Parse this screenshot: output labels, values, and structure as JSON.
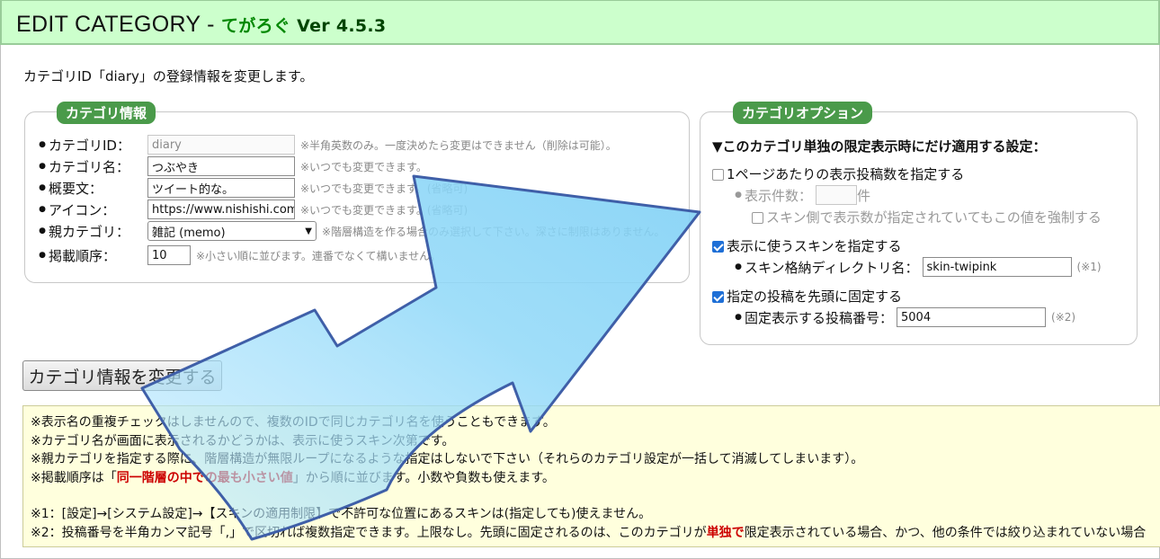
{
  "header": {
    "title_main": "EDIT CATEGORY - ",
    "title_app": "てがろぐ",
    "title_ver": " Ver 4.5.3"
  },
  "intro": "カテゴリID「diary」の登録情報を変更します。",
  "info": {
    "legend": "カテゴリ情報",
    "rows": [
      {
        "label": "カテゴリID：",
        "value": "diary",
        "note": "※半角英数のみ。一度決めたら変更はできません（削除は可能）。"
      },
      {
        "label": "カテゴリ名：",
        "value": "つぶやき",
        "note": "※いつでも変更できます。"
      },
      {
        "label": "概要文：",
        "value": "ツイート的な。",
        "note": "※いつでも変更できます。(省略可)"
      },
      {
        "label": "アイコン：",
        "value": "https://www.nishishi.com/c",
        "note": "※いつでも変更できます。(省略可)"
      },
      {
        "label": "親カテゴリ：",
        "value": "雑記 (memo)",
        "note": "※階層構造を作る場合のみ選択して下さい。深さに制限はありません。"
      },
      {
        "label": "掲載順序：",
        "value": "10",
        "note": "※小さい順に並びます。連番でなくて構いません。"
      }
    ]
  },
  "options": {
    "legend": "カテゴリオプション",
    "heading": "▼このカテゴリ単独の限定表示時にだけ適用する設定：",
    "opt1": {
      "label": "1ページあたりの表示投稿数を指定する",
      "sub_label": "表示件数：",
      "sub_unit": "件",
      "sub_value": "",
      "force_label": "スキン側で表示数が指定されていてもこの値を強制する"
    },
    "opt2": {
      "label": "表示に使うスキンを指定する",
      "sub_label": "スキン格納ディレクトリ名：",
      "sub_value": "skin-twipink",
      "mark": "(※1)"
    },
    "opt3": {
      "label": "指定の投稿を先頭に固定する",
      "sub_label": "固定表示する投稿番号：",
      "sub_value": "5004",
      "mark": "(※2)"
    }
  },
  "submit_label": "カテゴリ情報を変更する",
  "notes": {
    "line1": "※表示名の重複チェックはしませんので、複数のIDで同じカテゴリ名を使うこともできます。",
    "line2": "※カテゴリ名が画面に表示されるかどうかは、表示に使うスキン次第です。",
    "line3": "※親カテゴリを指定する際に、階層構造が無限ループになるような指定はしないで下さい（それらのカテゴリ設定が一括して消滅してしまいます）。",
    "line4_a": "※掲載順序は「",
    "line4_red": "同一階層の中での最も小さい値",
    "line4_b": "」から順に並びます。小数や負数も使えます。",
    "line5": "※1：[設定]→[システム設定]→【スキンの適用制限】で不許可な位置にあるスキンは(指定しても)使えません。",
    "line6_a": "※2：投稿番号を半角カンマ記号「,」で区切れば複数指定できます。上限なし。先頭に固定されるのは、このカテゴリが",
    "line6_red": "単独で",
    "line6_b": "限定表示されている場合、かつ、他の条件では絞り込まれていない場合"
  },
  "colors": {
    "header_bg": "#ccffcc",
    "legend_bg": "#4a9a4a",
    "notes_bg": "#ffffdd",
    "arrow": "#8fd8f8"
  }
}
